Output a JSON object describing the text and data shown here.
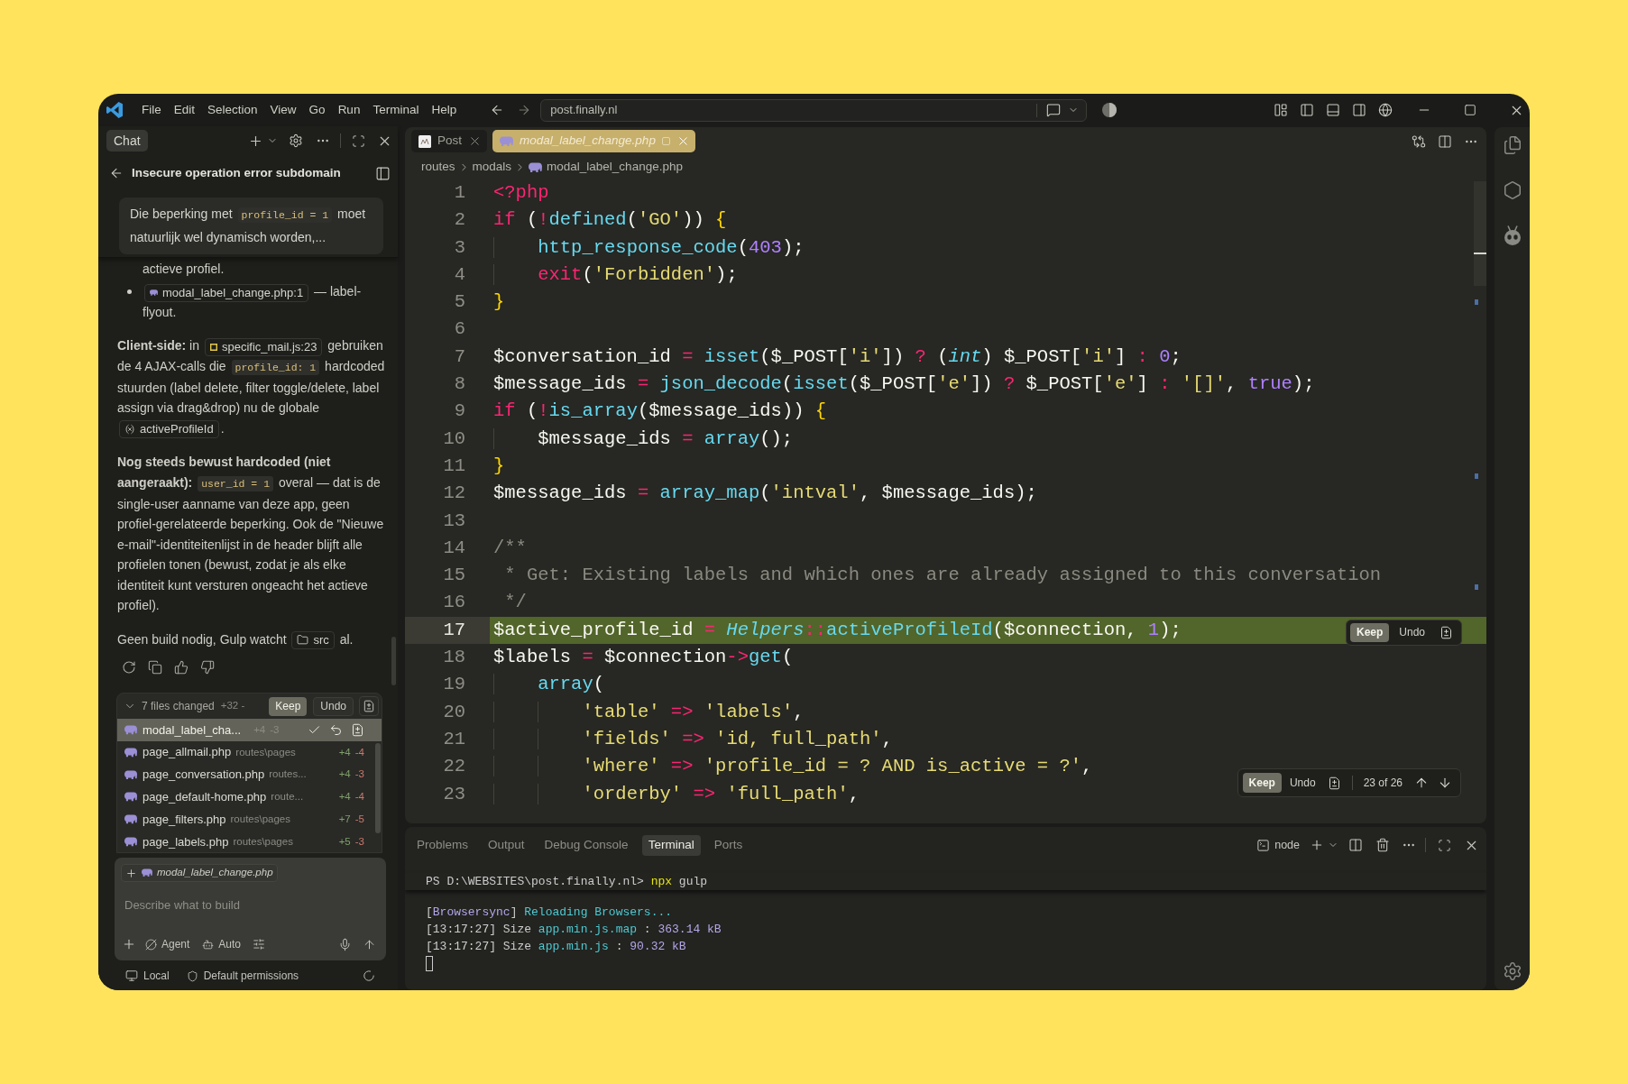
{
  "title_bar": {
    "menu": [
      "File",
      "Edit",
      "Selection",
      "View",
      "Go",
      "Run",
      "Terminal",
      "Help"
    ],
    "command_center": "post.finally.nl"
  },
  "chat": {
    "tab": "Chat",
    "title": "Insecure operation error subdomain",
    "request": [
      {
        "kind": "text",
        "text": "Die beperking met "
      },
      {
        "kind": "code",
        "text": "profile_id = 1"
      },
      {
        "kind": "text",
        "text": " moet natuurlijk wel dynamisch worden,..."
      }
    ],
    "response": [
      {
        "kind": "continuation",
        "parts": [
          {
            "kind": "text",
            "text": "actieve profiel."
          }
        ]
      },
      {
        "kind": "bullet",
        "parts": [
          {
            "kind": "php_file",
            "text": "modal_label_change.php:1"
          },
          {
            "kind": "text",
            "text": " — label-flyout."
          }
        ]
      },
      {
        "kind": "paragraph",
        "parts": [
          {
            "kind": "text",
            "text": "**Client-side:** in "
          },
          {
            "kind": "script_file",
            "text": "specific_mail.js:23"
          },
          {
            "kind": "text",
            "text": " gebruiken de 4 AJAX-calls die "
          },
          {
            "kind": "code",
            "text": "profile_id: 1"
          },
          {
            "kind": "text",
            "text": " hardcoded stuurden (label delete, filter toggle/delete, label assign via drag&drop) nu de globale "
          },
          {
            "kind": "symbol",
            "text": "activeProfileId"
          },
          {
            "kind": "text",
            "text": "."
          }
        ]
      },
      {
        "kind": "paragraph",
        "parts": [
          {
            "kind": "text",
            "text": "**Nog steeds bewust hardcoded (niet aangeraakt):** "
          },
          {
            "kind": "code",
            "text": "user_id = 1"
          },
          {
            "kind": "text",
            "text": " overal — dat is de single-user aanname van deze app, geen profiel-gerelateerde beperking. Ook de \"Nieuwe e-mail\"-identiteitenlijst in de header blijft alle profielen tonen (bewust, zodat je als elke identiteit kunt versturen ongeacht het actieve profiel)."
          }
        ]
      },
      {
        "kind": "paragraph",
        "parts": [
          {
            "kind": "text",
            "text": "Geen build nodig, Gulp watcht "
          },
          {
            "kind": "folder",
            "text": "src"
          },
          {
            "kind": "text",
            "text": " al."
          }
        ]
      }
    ],
    "changed_files": {
      "expanded": true,
      "summary": "7 files changed",
      "stats": "+32 -",
      "keep": "Keep",
      "undo": "Undo",
      "files": [
        {
          "name": "modal_label_cha...",
          "added": "+4",
          "removed": "-3",
          "selected": true
        },
        {
          "name": "page_allmail.php",
          "path": "routes\\pages",
          "added": "+4",
          "removed": "-4",
          "selected": false
        },
        {
          "name": "page_conversation.php",
          "path": "routes...",
          "added": "+4",
          "removed": "-3",
          "selected": false
        },
        {
          "name": "page_default-home.php",
          "path": "route...",
          "added": "+4",
          "removed": "-4",
          "selected": false
        },
        {
          "name": "page_filters.php",
          "path": "routes\\pages",
          "added": "+7",
          "removed": "-5",
          "selected": false
        },
        {
          "name": "page_labels.php",
          "path": "routes\\pages",
          "added": "+5",
          "removed": "-3",
          "selected": false
        }
      ]
    },
    "input": {
      "attachment": "modal_label_change.php",
      "placeholder": "Describe what to build",
      "mode": "Agent",
      "model": "Auto"
    },
    "footer": {
      "location": "Local",
      "permissions": "Default permissions"
    }
  },
  "editor": {
    "tabs": [
      {
        "kind": "image",
        "label": "Post",
        "selected": false,
        "preview": false,
        "edited": false
      },
      {
        "kind": "php",
        "label": "modal_label_change.php",
        "selected": true,
        "preview": true,
        "edited": true
      }
    ],
    "breadcrumb": [
      {
        "kind": "folder",
        "label": "routes"
      },
      {
        "kind": "folder",
        "label": "modals"
      },
      {
        "kind": "php",
        "label": "modal_label_change.php"
      }
    ],
    "lines": [
      {
        "number": "1",
        "changed": false,
        "tokens": [
          {
            "kind": "tag",
            "text": "<?php"
          }
        ]
      },
      {
        "number": "2",
        "changed": false,
        "tokens": [
          {
            "kind": "keyword",
            "text": "if"
          },
          {
            "kind": "plain",
            "text": " ("
          },
          {
            "kind": "op",
            "text": "!"
          },
          {
            "kind": "func",
            "text": "defined"
          },
          {
            "kind": "plain",
            "text": "("
          },
          {
            "kind": "string",
            "text": "'GO'"
          },
          {
            "kind": "plain",
            "text": ")) "
          },
          {
            "kind": "bracket",
            "text": "{"
          }
        ]
      },
      {
        "number": "3",
        "changed": false,
        "tokens": [
          {
            "kind": "func",
            "text": "    http_response_code"
          },
          {
            "kind": "plain",
            "text": "("
          },
          {
            "kind": "number",
            "text": "403"
          },
          {
            "kind": "plain",
            "text": ");"
          }
        ]
      },
      {
        "number": "4",
        "changed": false,
        "tokens": [
          {
            "kind": "keyword",
            "text": "    exit"
          },
          {
            "kind": "plain",
            "text": "("
          },
          {
            "kind": "string",
            "text": "'Forbidden'"
          },
          {
            "kind": "plain",
            "text": ");"
          }
        ]
      },
      {
        "number": "5",
        "changed": false,
        "tokens": [
          {
            "kind": "bracket",
            "text": "}"
          }
        ]
      },
      {
        "number": "6",
        "changed": false
      },
      {
        "number": "7",
        "changed": false,
        "tokens": [
          {
            "kind": "var",
            "text": "$conversation_id"
          },
          {
            "kind": "op",
            "text": " = "
          },
          {
            "kind": "func",
            "text": "isset"
          },
          {
            "kind": "plain",
            "text": "("
          },
          {
            "kind": "var",
            "text": "$_POST"
          },
          {
            "kind": "plain",
            "text": "["
          },
          {
            "kind": "string",
            "text": "'i'"
          },
          {
            "kind": "plain",
            "text": "])"
          },
          {
            "kind": "op",
            "text": " ? "
          },
          {
            "kind": "plain",
            "text": "("
          },
          {
            "kind": "type",
            "text": "int"
          },
          {
            "kind": "plain",
            "text": ") "
          },
          {
            "kind": "var",
            "text": "$_POST"
          },
          {
            "kind": "plain",
            "text": "["
          },
          {
            "kind": "string",
            "text": "'i'"
          },
          {
            "kind": "plain",
            "text": "]"
          },
          {
            "kind": "op",
            "text": " : "
          },
          {
            "kind": "number",
            "text": "0"
          },
          {
            "kind": "plain",
            "text": ";"
          }
        ]
      },
      {
        "number": "8",
        "changed": false,
        "tokens": [
          {
            "kind": "var",
            "text": "$message_ids"
          },
          {
            "kind": "op",
            "text": " = "
          },
          {
            "kind": "func",
            "text": "json_decode"
          },
          {
            "kind": "plain",
            "text": "("
          },
          {
            "kind": "func",
            "text": "isset"
          },
          {
            "kind": "plain",
            "text": "("
          },
          {
            "kind": "var",
            "text": "$_POST"
          },
          {
            "kind": "plain",
            "text": "["
          },
          {
            "kind": "string",
            "text": "'e'"
          },
          {
            "kind": "plain",
            "text": "])"
          },
          {
            "kind": "op",
            "text": " ? "
          },
          {
            "kind": "var",
            "text": "$_POST"
          },
          {
            "kind": "plain",
            "text": "["
          },
          {
            "kind": "string",
            "text": "'e'"
          },
          {
            "kind": "plain",
            "text": "]"
          },
          {
            "kind": "op",
            "text": " : "
          },
          {
            "kind": "string",
            "text": "'[]'"
          },
          {
            "kind": "plain",
            "text": ", "
          },
          {
            "kind": "const",
            "text": "true"
          },
          {
            "kind": "plain",
            "text": ");"
          }
        ]
      },
      {
        "number": "9",
        "changed": false,
        "tokens": [
          {
            "kind": "keyword",
            "text": "if"
          },
          {
            "kind": "plain",
            "text": " ("
          },
          {
            "kind": "op",
            "text": "!"
          },
          {
            "kind": "func",
            "text": "is_array"
          },
          {
            "kind": "plain",
            "text": "("
          },
          {
            "kind": "var",
            "text": "$message_ids"
          },
          {
            "kind": "plain",
            "text": ")) "
          },
          {
            "kind": "bracket",
            "text": "{"
          }
        ]
      },
      {
        "number": "10",
        "changed": false,
        "tokens": [
          {
            "kind": "var",
            "text": "    $message_ids"
          },
          {
            "kind": "op",
            "text": " = "
          },
          {
            "kind": "func",
            "text": "array"
          },
          {
            "kind": "plain",
            "text": "();"
          }
        ]
      },
      {
        "number": "11",
        "changed": false,
        "tokens": [
          {
            "kind": "bracket",
            "text": "}"
          }
        ]
      },
      {
        "number": "12",
        "changed": false,
        "tokens": [
          {
            "kind": "var",
            "text": "$message_ids"
          },
          {
            "kind": "op",
            "text": " = "
          },
          {
            "kind": "func",
            "text": "array_map"
          },
          {
            "kind": "plain",
            "text": "("
          },
          {
            "kind": "string",
            "text": "'intval'"
          },
          {
            "kind": "plain",
            "text": ", "
          },
          {
            "kind": "var",
            "text": "$message_ids"
          },
          {
            "kind": "plain",
            "text": ");"
          }
        ]
      },
      {
        "number": "13",
        "changed": false
      },
      {
        "number": "14",
        "changed": false,
        "tokens": [
          {
            "kind": "comment",
            "text": "/**"
          }
        ]
      },
      {
        "number": "15",
        "changed": false,
        "tokens": [
          {
            "kind": "comment",
            "text": " * Get: Existing labels and which ones are already assigned to this conversation"
          }
        ]
      },
      {
        "number": "16",
        "changed": false,
        "tokens": [
          {
            "kind": "comment",
            "text": " */"
          }
        ]
      },
      {
        "number": "17",
        "changed": true,
        "actions": {
          "keep": "Keep",
          "undo": "Undo"
        },
        "tokens": [
          {
            "kind": "var",
            "text": "$active_profile_id"
          },
          {
            "kind": "op",
            "text": " = "
          },
          {
            "kind": "class",
            "text": "Helpers"
          },
          {
            "kind": "op",
            "text": "::"
          },
          {
            "kind": "func",
            "text": "activeProfileId"
          },
          {
            "kind": "plain",
            "text": "("
          },
          {
            "kind": "var",
            "text": "$connection"
          },
          {
            "kind": "plain",
            "text": ", "
          },
          {
            "kind": "number",
            "text": "1"
          },
          {
            "kind": "plain",
            "text": ");"
          }
        ]
      },
      {
        "number": "18",
        "changed": false,
        "tokens": [
          {
            "kind": "var",
            "text": "$labels"
          },
          {
            "kind": "op",
            "text": " = "
          },
          {
            "kind": "var",
            "text": "$connection"
          },
          {
            "kind": "op",
            "text": "->"
          },
          {
            "kind": "func",
            "text": "get"
          },
          {
            "kind": "plain",
            "text": "("
          }
        ]
      },
      {
        "number": "19",
        "changed": false,
        "tokens": [
          {
            "kind": "func",
            "text": "    array"
          },
          {
            "kind": "plain",
            "text": "("
          }
        ]
      },
      {
        "number": "20",
        "changed": false,
        "tokens": [
          {
            "kind": "string",
            "text": "        'table'"
          },
          {
            "kind": "op",
            "text": " => "
          },
          {
            "kind": "string",
            "text": "'labels'"
          },
          {
            "kind": "plain",
            "text": ","
          }
        ]
      },
      {
        "number": "21",
        "changed": false,
        "tokens": [
          {
            "kind": "string",
            "text": "        'fields'"
          },
          {
            "kind": "op",
            "text": " => "
          },
          {
            "kind": "string",
            "text": "'id, full_path'"
          },
          {
            "kind": "plain",
            "text": ","
          }
        ]
      },
      {
        "number": "22",
        "changed": false,
        "tokens": [
          {
            "kind": "string",
            "text": "        'where'"
          },
          {
            "kind": "op",
            "text": " => "
          },
          {
            "kind": "string",
            "text": "'profile_id = ? AND is_active = ?'"
          },
          {
            "kind": "plain",
            "text": ","
          }
        ]
      },
      {
        "number": "23",
        "changed": false,
        "tokens": [
          {
            "kind": "string",
            "text": "        'orderby'"
          },
          {
            "kind": "op",
            "text": " => "
          },
          {
            "kind": "string",
            "text": "'full_path'"
          },
          {
            "kind": "plain",
            "text": ","
          }
        ]
      }
    ],
    "navigator": {
      "keep": "Keep",
      "undo": "Undo",
      "position": "23 of 26"
    }
  },
  "panel": {
    "tabs": [
      {
        "label": "Problems",
        "selected": false
      },
      {
        "label": "Output",
        "selected": false
      },
      {
        "label": "Debug Console",
        "selected": false
      },
      {
        "label": "Terminal",
        "selected": true
      },
      {
        "label": "Ports",
        "selected": false
      }
    ],
    "terminal_name": "node",
    "terminal": {
      "prompt": [
        {
          "kind": "plain",
          "text": "PS D:\\WEBSITES\\post.finally.nl> "
        },
        {
          "kind": "command",
          "text": "npx"
        },
        {
          "kind": "plain",
          "text": " gulp"
        }
      ],
      "lines": [
        {
          "tokens": [
            {
              "kind": "plain",
              "text": "["
            },
            {
              "kind": "accent",
              "text": "Browsersync"
            },
            {
              "kind": "plain",
              "text": "] "
            },
            {
              "kind": "info",
              "text": "Reloading Browsers..."
            }
          ]
        },
        {
          "tokens": [
            {
              "kind": "plain",
              "text": "[13:17:27] Size "
            },
            {
              "kind": "info",
              "text": "app.min.js.map"
            },
            {
              "kind": "plain",
              "text": " : "
            },
            {
              "kind": "accent",
              "text": "363.14 kB"
            }
          ]
        },
        {
          "tokens": [
            {
              "kind": "plain",
              "text": "[13:17:27] Size "
            },
            {
              "kind": "info",
              "text": "app.min.js"
            },
            {
              "kind": "plain",
              "text": " : "
            },
            {
              "kind": "accent",
              "text": "90.32 kB"
            }
          ]
        }
      ]
    }
  }
}
